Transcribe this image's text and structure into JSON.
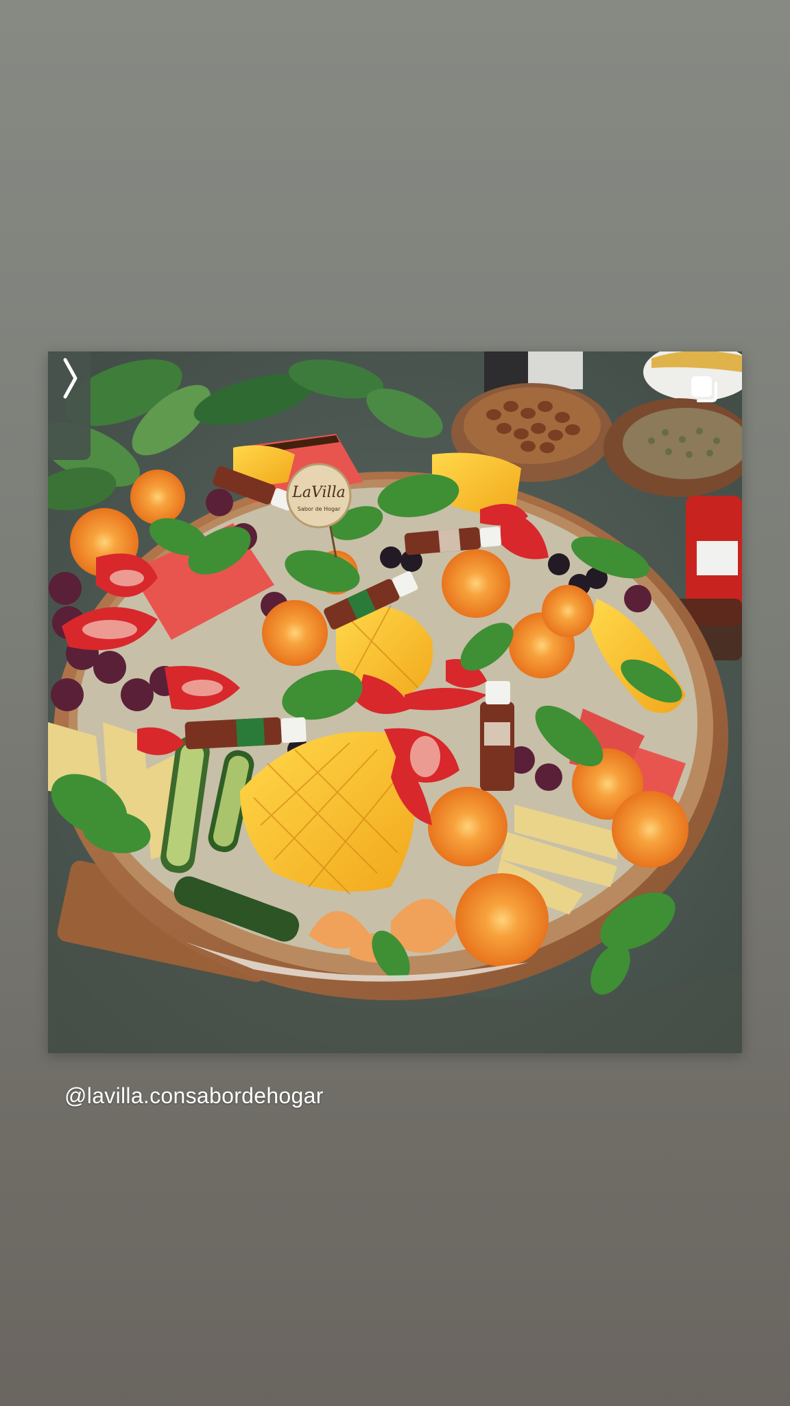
{
  "story": {
    "mention": "@lavilla.consabordehogar",
    "sign_text": "LaVilla",
    "sign_subtext": "Sabor de Hogar"
  },
  "icons": {
    "nav": "chevron-right-icon",
    "multi": "multiple-images-icon"
  },
  "colors": {
    "background_top": "#868a83",
    "background_bottom": "#6a6560",
    "mention_text": "#ffffff"
  }
}
